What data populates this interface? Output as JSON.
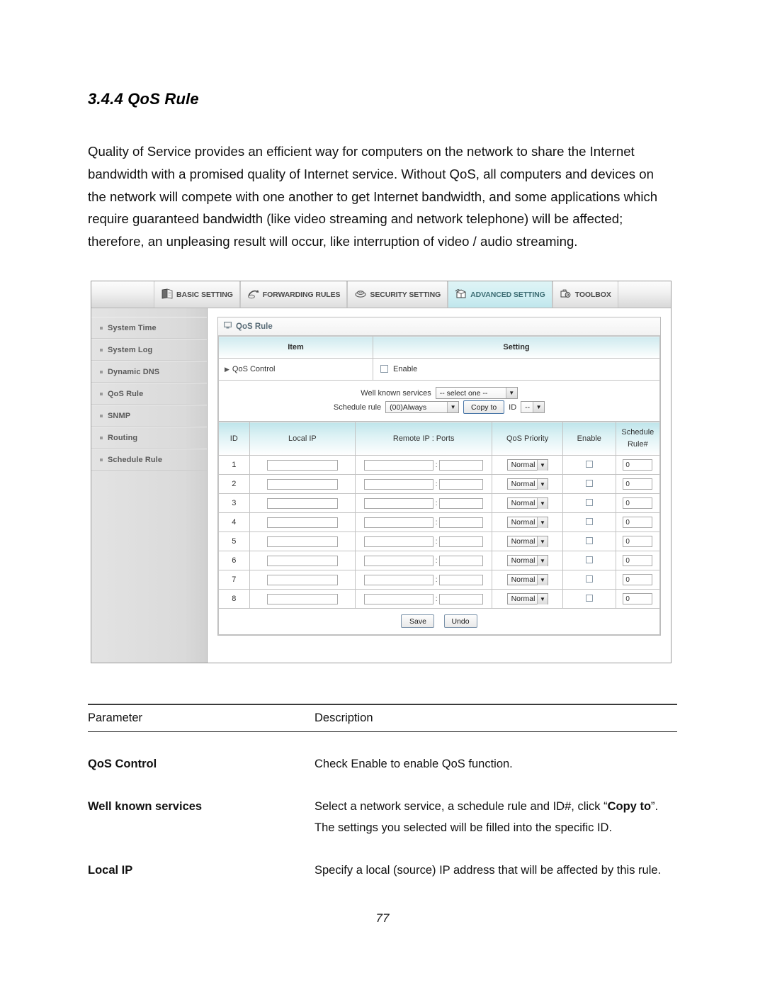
{
  "document": {
    "heading": "3.4.4 QoS Rule",
    "intro": "Quality of Service provides an efficient way for computers on the network to share the Internet bandwidth with a promised quality of Internet service. Without QoS, all computers and devices on the network will compete with one another to get Internet bandwidth, and some applications which require guaranteed bandwidth (like video streaming and network telephone) will be affected; therefore, an unpleasing result will occur, like interruption of video / audio streaming.",
    "page_number": "77"
  },
  "router_ui": {
    "nav_tabs": [
      {
        "label": "BASIC SETTING",
        "icon": "book-icon",
        "active": false
      },
      {
        "label": "FORWARDING RULES",
        "icon": "forwarding-arrow-icon",
        "active": false
      },
      {
        "label": "SECURITY SETTING",
        "icon": "shield-icon",
        "active": false
      },
      {
        "label": "ADVANCED SETTING",
        "icon": "gear-box-icon",
        "active": true
      },
      {
        "label": "TOOLBOX",
        "icon": "toolbox-icon",
        "active": false
      }
    ],
    "sidebar": {
      "items": [
        {
          "label": "System Time"
        },
        {
          "label": "System Log"
        },
        {
          "label": "Dynamic DNS"
        },
        {
          "label": "QoS Rule"
        },
        {
          "label": "SNMP"
        },
        {
          "label": "Routing"
        },
        {
          "label": "Schedule Rule"
        }
      ]
    },
    "panel": {
      "title": "QoS Rule",
      "title_icon": "monitor-icon",
      "columns": {
        "item": "Item",
        "setting": "Setting"
      },
      "qos_control": {
        "label": "QoS Control",
        "checkbox_label": "Enable",
        "checked": false
      },
      "well_known": {
        "services_label": "Well known services",
        "services_value": "-- select one --",
        "schedule_label": "Schedule rule",
        "schedule_value": "(00)Always",
        "copy_button": "Copy to",
        "id_label": "ID",
        "id_value": "--"
      },
      "rules_table": {
        "headers": {
          "id": "ID",
          "local_ip": "Local IP",
          "remote": "Remote IP : Ports",
          "priority": "QoS Priority",
          "enable": "Enable",
          "schedule_line1": "Schedule",
          "schedule_line2": "Rule#"
        },
        "separator": ":",
        "rows": [
          {
            "id": "1",
            "local_ip": "",
            "remote_ip": "",
            "port": "",
            "priority": "Normal",
            "enable": false,
            "schedule_rule": "0"
          },
          {
            "id": "2",
            "local_ip": "",
            "remote_ip": "",
            "port": "",
            "priority": "Normal",
            "enable": false,
            "schedule_rule": "0"
          },
          {
            "id": "3",
            "local_ip": "",
            "remote_ip": "",
            "port": "",
            "priority": "Normal",
            "enable": false,
            "schedule_rule": "0"
          },
          {
            "id": "4",
            "local_ip": "",
            "remote_ip": "",
            "port": "",
            "priority": "Normal",
            "enable": false,
            "schedule_rule": "0"
          },
          {
            "id": "5",
            "local_ip": "",
            "remote_ip": "",
            "port": "",
            "priority": "Normal",
            "enable": false,
            "schedule_rule": "0"
          },
          {
            "id": "6",
            "local_ip": "",
            "remote_ip": "",
            "port": "",
            "priority": "Normal",
            "enable": false,
            "schedule_rule": "0"
          },
          {
            "id": "7",
            "local_ip": "",
            "remote_ip": "",
            "port": "",
            "priority": "Normal",
            "enable": false,
            "schedule_rule": "0"
          },
          {
            "id": "8",
            "local_ip": "",
            "remote_ip": "",
            "port": "",
            "priority": "Normal",
            "enable": false,
            "schedule_rule": "0"
          }
        ]
      },
      "actions": {
        "save": "Save",
        "undo": "Undo"
      }
    }
  },
  "param_table": {
    "head": {
      "parameter": "Parameter",
      "description": "Description"
    },
    "rows": [
      {
        "parameter": "QoS Control",
        "description": "Check Enable to enable QoS function."
      },
      {
        "parameter": "Well known services",
        "description_pre": "Select a network service, a schedule rule and ID#, click “",
        "description_bold1": "Copy to",
        "description_mid": "”. The settings you selected will be filled into the specific ID.",
        "description": ""
      },
      {
        "parameter": "Local IP",
        "description": "Specify a local (source) IP address that will be affected by this rule."
      }
    ]
  }
}
